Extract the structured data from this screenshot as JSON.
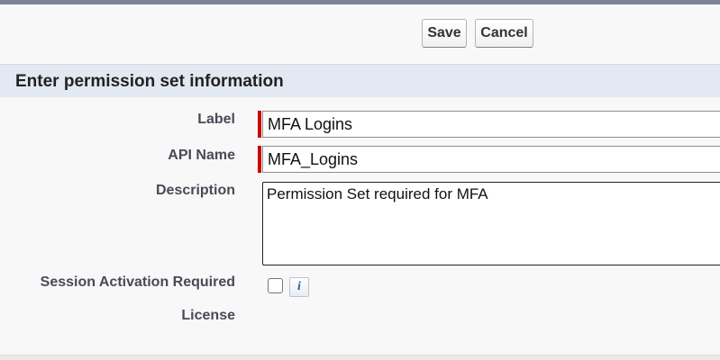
{
  "toolbar": {
    "save_label": "Save",
    "cancel_label": "Cancel"
  },
  "section": {
    "title": "Enter permission set information"
  },
  "form": {
    "label_field": {
      "label": "Label",
      "value": "MFA Logins",
      "required": true
    },
    "api_name_field": {
      "label": "API Name",
      "value": "MFA_Logins",
      "required": true
    },
    "description_field": {
      "label": "Description",
      "value": "Permission Set required for MFA"
    },
    "session_activation": {
      "label": "Session Activation Required",
      "checked": false,
      "info_icon": "info-icon"
    },
    "license": {
      "label": "License",
      "value": ""
    }
  },
  "colors": {
    "required_marker": "#cc0000",
    "section_header_bg": "#e3e9f2",
    "top_border": "#7d8594"
  }
}
